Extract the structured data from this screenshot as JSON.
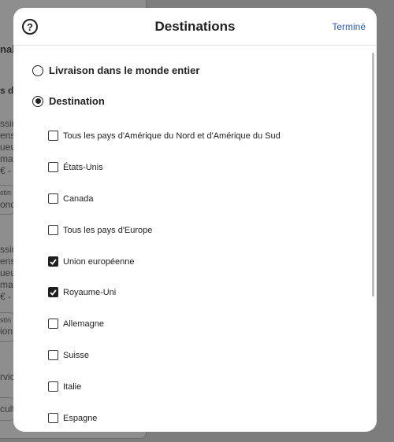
{
  "background": {
    "snippets": [
      "nal",
      "s de",
      "ssim",
      "ensi",
      "ueu",
      "mat",
      "€ -",
      "stin",
      "ond",
      "ssim",
      "ensi",
      "ueu",
      "mat",
      "€ -",
      "stin",
      "ion",
      "rvic",
      "cult"
    ]
  },
  "modal": {
    "title": "Destinations",
    "help_icon_glyph": "?",
    "done_label": "Terminé",
    "options": [
      {
        "label": "Livraison dans le monde entier",
        "selected": false
      },
      {
        "label": "Destination",
        "selected": true
      }
    ],
    "countries": [
      {
        "label": "Tous les pays d'Amérique du Nord et d'Amérique du Sud",
        "checked": false
      },
      {
        "label": "États-Unis",
        "checked": false
      },
      {
        "label": "Canada",
        "checked": false
      },
      {
        "label": "Tous les pays d'Europe",
        "checked": false
      },
      {
        "label": "Union européenne",
        "checked": true
      },
      {
        "label": "Royaume-Uni",
        "checked": true
      },
      {
        "label": "Allemagne",
        "checked": false
      },
      {
        "label": "Suisse",
        "checked": false
      },
      {
        "label": "Italie",
        "checked": false
      },
      {
        "label": "Espagne",
        "checked": false
      }
    ]
  }
}
